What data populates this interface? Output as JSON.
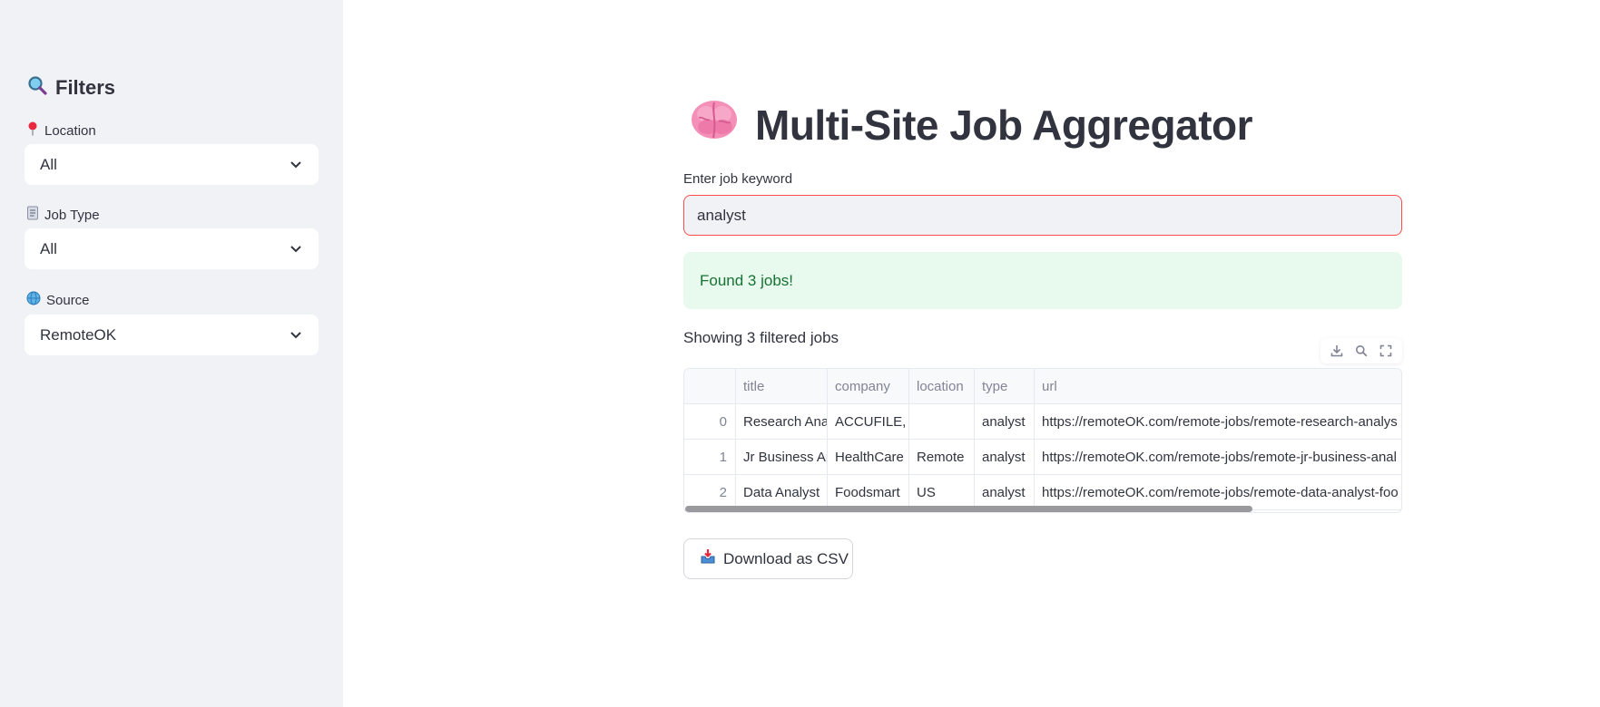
{
  "sidebar": {
    "title": "Filters",
    "title_icon": "magnifier-icon",
    "filters": [
      {
        "label": "Location",
        "icon": "pin-icon",
        "value": "All"
      },
      {
        "label": "Job Type",
        "icon": "document-icon",
        "value": "All"
      },
      {
        "label": "Source",
        "icon": "globe-icon",
        "value": "RemoteOK"
      }
    ]
  },
  "main": {
    "title": "Multi-Site Job Aggregator",
    "title_icon": "brain-icon",
    "keyword_label": "Enter job keyword",
    "keyword_value": "analyst",
    "success_message": "Found 3 jobs!",
    "showing_text": "Showing 3 filtered jobs",
    "toolbar": [
      "download-icon",
      "search-icon",
      "fullscreen-icon"
    ],
    "table": {
      "columns": [
        "",
        "title",
        "company",
        "location",
        "type",
        "url"
      ],
      "rows": [
        [
          "0",
          "Research Anal",
          "ACCUFILE, IN",
          "",
          "analyst",
          "https://remoteOK.com/remote-jobs/remote-research-analys"
        ],
        [
          "1",
          "Jr Business An",
          "HealthCare",
          "Remote",
          "analyst",
          "https://remoteOK.com/remote-jobs/remote-jr-business-anal"
        ],
        [
          "2",
          "Data Analyst",
          "Foodsmart",
          "US",
          "analyst",
          "https://remoteOK.com/remote-jobs/remote-data-analyst-foo"
        ]
      ]
    },
    "download_label": "Download as CSV",
    "download_icon": "inbox-tray-icon"
  },
  "colors": {
    "accent": "#ff4b4b",
    "success_bg": "#e8f9ee",
    "success_text": "#177233",
    "sidebar_bg": "#f0f2f6"
  }
}
